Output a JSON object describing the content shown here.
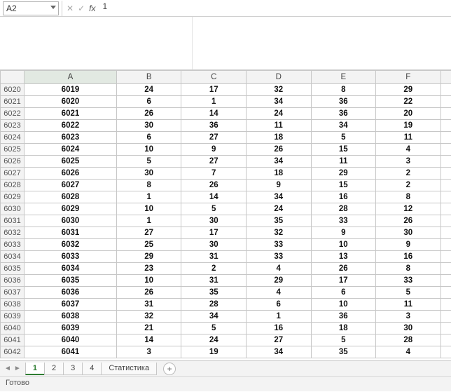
{
  "formula_bar": {
    "name_box": "A2",
    "cancel_glyph": "✕",
    "confirm_glyph": "✓",
    "fx_label": "fx",
    "input_value": "1"
  },
  "columns": [
    "A",
    "B",
    "C",
    "D",
    "E",
    "F"
  ],
  "row_headers": [
    "6020",
    "6021",
    "6022",
    "6023",
    "6024",
    "6025",
    "6026",
    "6027",
    "6028",
    "6029",
    "6030",
    "6031",
    "6032",
    "6033",
    "6034",
    "6035",
    "6036",
    "6037",
    "6038",
    "6039",
    "6040",
    "6041",
    "6042"
  ],
  "rows": [
    [
      "6019",
      "24",
      "17",
      "32",
      "8",
      "29"
    ],
    [
      "6020",
      "6",
      "1",
      "34",
      "36",
      "22"
    ],
    [
      "6021",
      "26",
      "14",
      "24",
      "36",
      "20"
    ],
    [
      "6022",
      "30",
      "36",
      "11",
      "34",
      "19"
    ],
    [
      "6023",
      "6",
      "27",
      "18",
      "5",
      "11"
    ],
    [
      "6024",
      "10",
      "9",
      "26",
      "15",
      "4"
    ],
    [
      "6025",
      "5",
      "27",
      "34",
      "11",
      "3"
    ],
    [
      "6026",
      "30",
      "7",
      "18",
      "29",
      "2"
    ],
    [
      "6027",
      "8",
      "26",
      "9",
      "15",
      "2"
    ],
    [
      "6028",
      "1",
      "14",
      "34",
      "16",
      "8"
    ],
    [
      "6029",
      "10",
      "5",
      "24",
      "28",
      "12"
    ],
    [
      "6030",
      "1",
      "30",
      "35",
      "33",
      "26"
    ],
    [
      "6031",
      "27",
      "17",
      "32",
      "9",
      "30"
    ],
    [
      "6032",
      "25",
      "30",
      "33",
      "10",
      "9"
    ],
    [
      "6033",
      "29",
      "31",
      "33",
      "13",
      "16"
    ],
    [
      "6034",
      "23",
      "2",
      "4",
      "26",
      "8"
    ],
    [
      "6035",
      "10",
      "31",
      "29",
      "17",
      "33"
    ],
    [
      "6036",
      "26",
      "35",
      "4",
      "6",
      "5"
    ],
    [
      "6037",
      "31",
      "28",
      "6",
      "10",
      "11"
    ],
    [
      "6038",
      "32",
      "34",
      "1",
      "36",
      "3"
    ],
    [
      "6039",
      "21",
      "5",
      "16",
      "18",
      "30"
    ],
    [
      "6040",
      "14",
      "24",
      "27",
      "5",
      "28"
    ],
    [
      "6041",
      "3",
      "19",
      "34",
      "35",
      "4"
    ]
  ],
  "tabs": {
    "nav_prev": "◄",
    "nav_next": "►",
    "items": [
      "1",
      "2",
      "3",
      "4",
      "Статистика"
    ],
    "active_index": 0,
    "add_glyph": "+"
  },
  "status": {
    "ready": "Готово"
  },
  "chart_data": {
    "type": "table",
    "title": "",
    "columns": [
      "A",
      "B",
      "C",
      "D",
      "E",
      "F"
    ],
    "row_index": [
      6020,
      6021,
      6022,
      6023,
      6024,
      6025,
      6026,
      6027,
      6028,
      6029,
      6030,
      6031,
      6032,
      6033,
      6034,
      6035,
      6036,
      6037,
      6038,
      6039,
      6040,
      6041,
      6042
    ],
    "data": [
      [
        6019,
        24,
        17,
        32,
        8,
        29
      ],
      [
        6020,
        6,
        1,
        34,
        36,
        22
      ],
      [
        6021,
        26,
        14,
        24,
        36,
        20
      ],
      [
        6022,
        30,
        36,
        11,
        34,
        19
      ],
      [
        6023,
        6,
        27,
        18,
        5,
        11
      ],
      [
        6024,
        10,
        9,
        26,
        15,
        4
      ],
      [
        6025,
        5,
        27,
        34,
        11,
        3
      ],
      [
        6026,
        30,
        7,
        18,
        29,
        2
      ],
      [
        6027,
        8,
        26,
        9,
        15,
        2
      ],
      [
        6028,
        1,
        14,
        34,
        16,
        8
      ],
      [
        6029,
        10,
        5,
        24,
        28,
        12
      ],
      [
        6030,
        1,
        30,
        35,
        33,
        26
      ],
      [
        6031,
        27,
        17,
        32,
        9,
        30
      ],
      [
        6032,
        25,
        30,
        33,
        10,
        9
      ],
      [
        6033,
        29,
        31,
        33,
        13,
        16
      ],
      [
        6034,
        23,
        2,
        4,
        26,
        8
      ],
      [
        6035,
        10,
        31,
        29,
        17,
        33
      ],
      [
        6036,
        26,
        35,
        4,
        6,
        5
      ],
      [
        6037,
        31,
        28,
        6,
        10,
        11
      ],
      [
        6038,
        32,
        34,
        1,
        36,
        3
      ],
      [
        6039,
        21,
        5,
        16,
        18,
        30
      ],
      [
        6040,
        14,
        24,
        27,
        5,
        28
      ],
      [
        6041,
        3,
        19,
        34,
        35,
        4
      ]
    ]
  }
}
